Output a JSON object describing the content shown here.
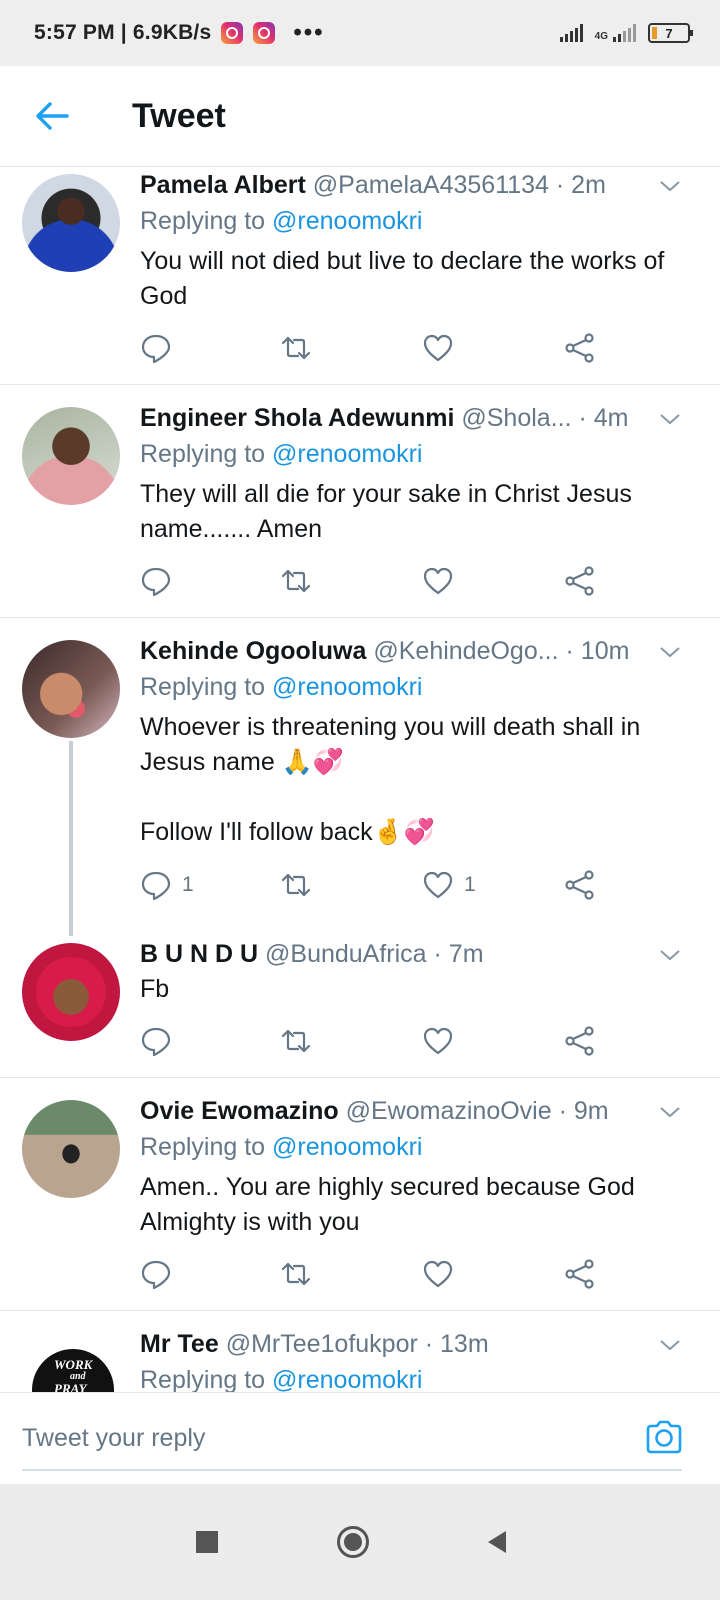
{
  "status_bar": {
    "time": "5:57 PM | 6.9KB/s",
    "network": "4G",
    "battery_level": "7",
    "battery_color": "#e69a2a"
  },
  "header": {
    "title": "Tweet",
    "back_icon": "arrow-left-icon",
    "accent_color": "#1da1f2"
  },
  "tweets": [
    {
      "name": "Pamela Albert",
      "meta": "@PamelaA43561134 · 2m",
      "replying_prefix": "Replying to",
      "replying_to": "@renoomokri",
      "text": "You will not died but live to declare the works of God",
      "reply_count": "",
      "like_count": ""
    },
    {
      "name": "Engineer Shola Adewunmi",
      "meta": "@Shola... · 4m",
      "replying_prefix": "Replying to",
      "replying_to": "@renoomokri",
      "text": "They will all die for your sake in Christ Jesus name....... Amen",
      "reply_count": "",
      "like_count": ""
    },
    {
      "name": "Kehinde Ogooluwa",
      "meta": "@KehindeOgo... · 10m",
      "replying_prefix": "Replying to",
      "replying_to": "@renoomokri",
      "text": "Whoever is threatening you will death shall in Jesus name 🙏💞\n\nFollow I'll follow back🤞💞",
      "reply_count": "1",
      "like_count": "1"
    },
    {
      "name": "B U N D U",
      "meta": "@BunduAfrica · 7m",
      "text": "Fb",
      "reply_count": "",
      "like_count": ""
    },
    {
      "name": "Ovie Ewomazino",
      "meta": "@EwomazinoOvie · 9m",
      "replying_prefix": "Replying to",
      "replying_to": "@renoomokri",
      "text": "Amen.. You are highly secured because God Almighty is with you",
      "reply_count": "",
      "like_count": ""
    },
    {
      "name": "Mr Tee",
      "meta": "@MrTee1ofukpor · 13m",
      "replying_prefix": "Replying to",
      "replying_to": "@renoomokri",
      "avatar_text_1": "WORK",
      "avatar_text_2": "and",
      "avatar_text_3": "PRAY"
    }
  ],
  "reply_bar": {
    "placeholder": "Tweet your reply",
    "camera_icon": "camera-icon"
  },
  "nav_bar": {
    "recents_icon": "square-icon",
    "home_icon": "circle-icon",
    "back_icon": "triangle-back-icon"
  }
}
